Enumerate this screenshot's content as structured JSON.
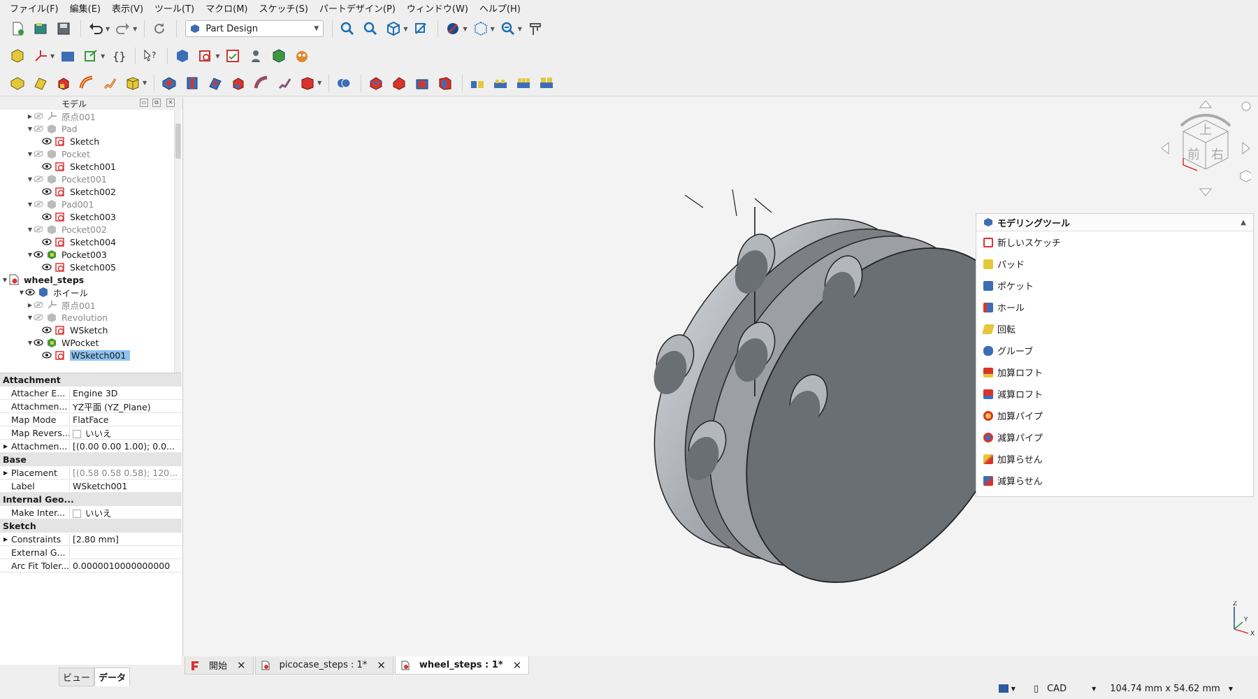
{
  "menu": [
    "ファイル(F)",
    "編集(E)",
    "表示(V)",
    "ツール(T)",
    "マクロ(M)",
    "スケッチ(S)",
    "パートデザイン(P)",
    "ウィンドウ(W)",
    "ヘルプ(H)"
  ],
  "workbench": {
    "selected": "Part Design"
  },
  "panel": {
    "title": "モデル"
  },
  "tree": [
    {
      "label": "原点001",
      "dim": true
    },
    {
      "label": "Pad",
      "dim": true
    },
    {
      "label": "Sketch"
    },
    {
      "label": "Pocket",
      "dim": true
    },
    {
      "label": "Sketch001"
    },
    {
      "label": "Pocket001",
      "dim": true
    },
    {
      "label": "Sketch002"
    },
    {
      "label": "Pad001",
      "dim": true
    },
    {
      "label": "Sketch003"
    },
    {
      "label": "Pocket002",
      "dim": true
    },
    {
      "label": "Sketch004"
    },
    {
      "label": "Pocket003"
    },
    {
      "label": "Sketch005"
    },
    {
      "label": "wheel_steps"
    },
    {
      "label": "ホイール"
    },
    {
      "label": "原点001",
      "dim": true
    },
    {
      "label": "Revolution",
      "dim": true
    },
    {
      "label": "WSketch"
    },
    {
      "label": "WPocket"
    },
    {
      "label": "WSketch001"
    }
  ],
  "props": {
    "groups": [
      "Attachment",
      "Base",
      "Internal Geo...",
      "Sketch"
    ],
    "rows": [
      {
        "k": "Attacher E...",
        "v": "Engine 3D"
      },
      {
        "k": "Attachmen...",
        "v": "YZ平面 (YZ_Plane)"
      },
      {
        "k": "Map Mode",
        "v": "FlatFace"
      },
      {
        "k": "Map Revers...",
        "v": "いいえ"
      },
      {
        "k": "Attachmen...",
        "v": "[(0.00 0.00 1.00); 0.0..."
      },
      {
        "k": "Placement",
        "v": "[(0.58 0.58 0.58); 120..."
      },
      {
        "k": "Label",
        "v": "WSketch001"
      },
      {
        "k": "Make Inter...",
        "v": "いいえ"
      },
      {
        "k": "Constraints",
        "v": "[2.80 mm]"
      },
      {
        "k": "External G...",
        "v": ""
      },
      {
        "k": "Arc Fit Toler...",
        "v": "0.0000010000000000"
      }
    ]
  },
  "left_tabs": [
    "ビュー",
    "データ"
  ],
  "tasks": {
    "title": "モデリングツール",
    "items": [
      "新しいスケッチ",
      "パッド",
      "ポケット",
      "ホール",
      "回転",
      "グルーブ",
      "加算ロフト",
      "減算ロフト",
      "加算パイプ",
      "減算パイプ",
      "加算らせん",
      "減算らせん"
    ]
  },
  "navcube": {
    "top": "上",
    "front": "前",
    "right": "右"
  },
  "axis": {
    "x": "X",
    "y": "Y",
    "z": "Z"
  },
  "doc_tabs": [
    "開始",
    "picocase_steps : 1*",
    "wheel_steps : 1*"
  ],
  "status": {
    "nav": "CAD",
    "dims": "104.74 mm x 54.62 mm"
  },
  "colors": {
    "selection": "#8ec2f0",
    "part": "#6b7075",
    "part_side": "#a5a9ae"
  }
}
